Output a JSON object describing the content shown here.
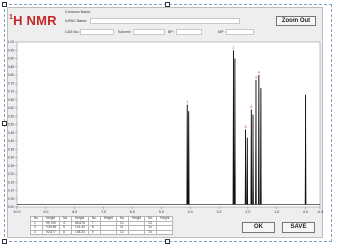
{
  "header": {
    "title_prefix": "1",
    "title_main": "H NMR",
    "common_name_label": "Common Name:",
    "iupac_label": "IUPAC Name:",
    "cas_label": "CAS No.:",
    "solvent_label": "Solvent:",
    "bp_label": "BP:",
    "mp_label": "MP:"
  },
  "buttons": {
    "zoom_out": "Zoom Out",
    "ok": "OK",
    "save": "SAVE"
  },
  "colors": {
    "title": "#c62828",
    "peak_label": "#c62828",
    "spectrum": "#111111"
  },
  "peak_table": {
    "headers": [
      "No.",
      "Height",
      "No.",
      "Height",
      "No.",
      "Height",
      "No.",
      "Height",
      "No.",
      "Height"
    ],
    "rows": [
      [
        "1",
        "99.755",
        "4",
        "86.678",
        "7",
        "",
        "10",
        "",
        "13",
        ""
      ],
      [
        "2",
        "Y30.98",
        "5",
        "101.44",
        "8",
        "",
        "11",
        "",
        "14",
        ""
      ],
      [
        "3",
        "92.877",
        "6",
        "108.33",
        "9",
        "",
        "12",
        "",
        "15",
        ""
      ]
    ]
  },
  "chart_data": {
    "type": "line",
    "title": "",
    "xlabel": "",
    "ylabel": "",
    "xlim": [
      10.0,
      -0.5
    ],
    "ylim": [
      0.0,
      1.0
    ],
    "x_ticks": [
      "10.0",
      "9.0",
      "8.0",
      "7.0",
      "6.0",
      "5.0",
      "4.0",
      "3.0",
      "2.0",
      "1.0",
      "0.0",
      "-0.5"
    ],
    "x_tick_values": [
      10,
      9,
      8,
      7,
      6,
      5,
      4,
      3,
      2,
      1,
      0,
      -0.5
    ],
    "y_ticks": [
      "1.00",
      "0.95",
      "0.90",
      "0.85",
      "0.80",
      "0.75",
      "0.70",
      "0.65",
      "0.60",
      "0.55",
      "0.50",
      "0.45",
      "0.40",
      "0.35",
      "0.30",
      "0.25",
      "0.20",
      "0.15",
      "0.10",
      "0.05",
      "0.00"
    ],
    "y_tick_values": [
      1.0,
      0.95,
      0.9,
      0.85,
      0.8,
      0.75,
      0.7,
      0.65,
      0.6,
      0.55,
      0.5,
      0.45,
      0.4,
      0.35,
      0.3,
      0.25,
      0.2,
      0.15,
      0.1,
      0.05,
      0.0
    ],
    "grid": false,
    "peaks": [
      {
        "x": 4.1,
        "y": 0.62,
        "label": "1"
      },
      {
        "x": 4.05,
        "y": 0.58,
        "label": ""
      },
      {
        "x": 2.08,
        "y": 0.47,
        "label": "5"
      },
      {
        "x": 2.02,
        "y": 0.42,
        "label": ""
      },
      {
        "x": 1.88,
        "y": 0.59,
        "label": "6"
      },
      {
        "x": 1.82,
        "y": 0.56,
        "label": ""
      },
      {
        "x": 1.72,
        "y": 0.77,
        "label": "3"
      },
      {
        "x": 1.62,
        "y": 0.8,
        "label": "4"
      },
      {
        "x": 1.55,
        "y": 0.72,
        "label": ""
      },
      {
        "x": 2.5,
        "y": 0.95,
        "label": "2"
      },
      {
        "x": 2.45,
        "y": 0.9,
        "label": ""
      },
      {
        "x": 0.0,
        "y": 0.68,
        "label": ""
      }
    ],
    "baseline": 0.015
  }
}
